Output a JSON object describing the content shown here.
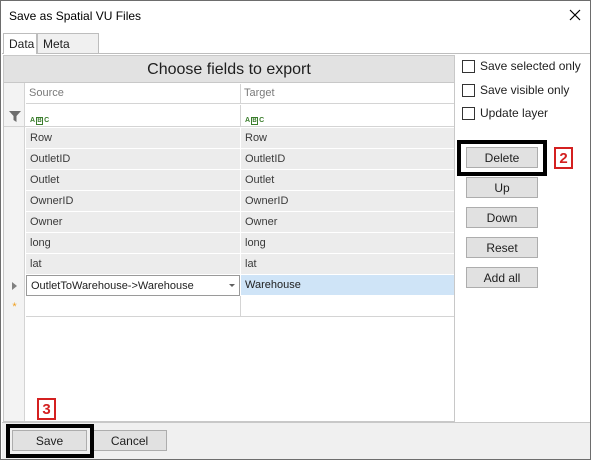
{
  "window": {
    "title": "Save as Spatial VU Files"
  },
  "tabs": [
    {
      "label": "Data",
      "active": true
    },
    {
      "label": "Meta Data",
      "active": false
    }
  ],
  "grid": {
    "title": "Choose fields to export",
    "columns": [
      "Source",
      "Target"
    ],
    "rows": [
      {
        "source": "Row",
        "target": "Row"
      },
      {
        "source": "OutletID",
        "target": "OutletID"
      },
      {
        "source": "Outlet",
        "target": "Outlet"
      },
      {
        "source": "OwnerID",
        "target": "OwnerID"
      },
      {
        "source": "Owner",
        "target": "Owner"
      },
      {
        "source": "long",
        "target": "long"
      },
      {
        "source": "lat",
        "target": "lat"
      },
      {
        "source": "OutletToWarehouse->Warehouse",
        "target": "Warehouse"
      }
    ],
    "new_row_marker": "*"
  },
  "options": {
    "save_selected_only": {
      "label": "Save selected only",
      "checked": false
    },
    "save_visible_only": {
      "label": "Save visible only",
      "checked": false
    },
    "update_layer": {
      "label": "Update layer",
      "checked": false
    }
  },
  "side_buttons": {
    "delete": "Delete",
    "up": "Up",
    "down": "Down",
    "reset": "Reset",
    "add_all": "Add all"
  },
  "footer": {
    "save": "Save",
    "cancel": "Cancel"
  },
  "annotations": {
    "step2": "2",
    "step3": "3",
    "color": "#d42020"
  },
  "colors": {
    "selected_target_bg": "#cfe4f7",
    "row_bg": "#ececec",
    "title_bar_bg": "#e2e2e2"
  }
}
